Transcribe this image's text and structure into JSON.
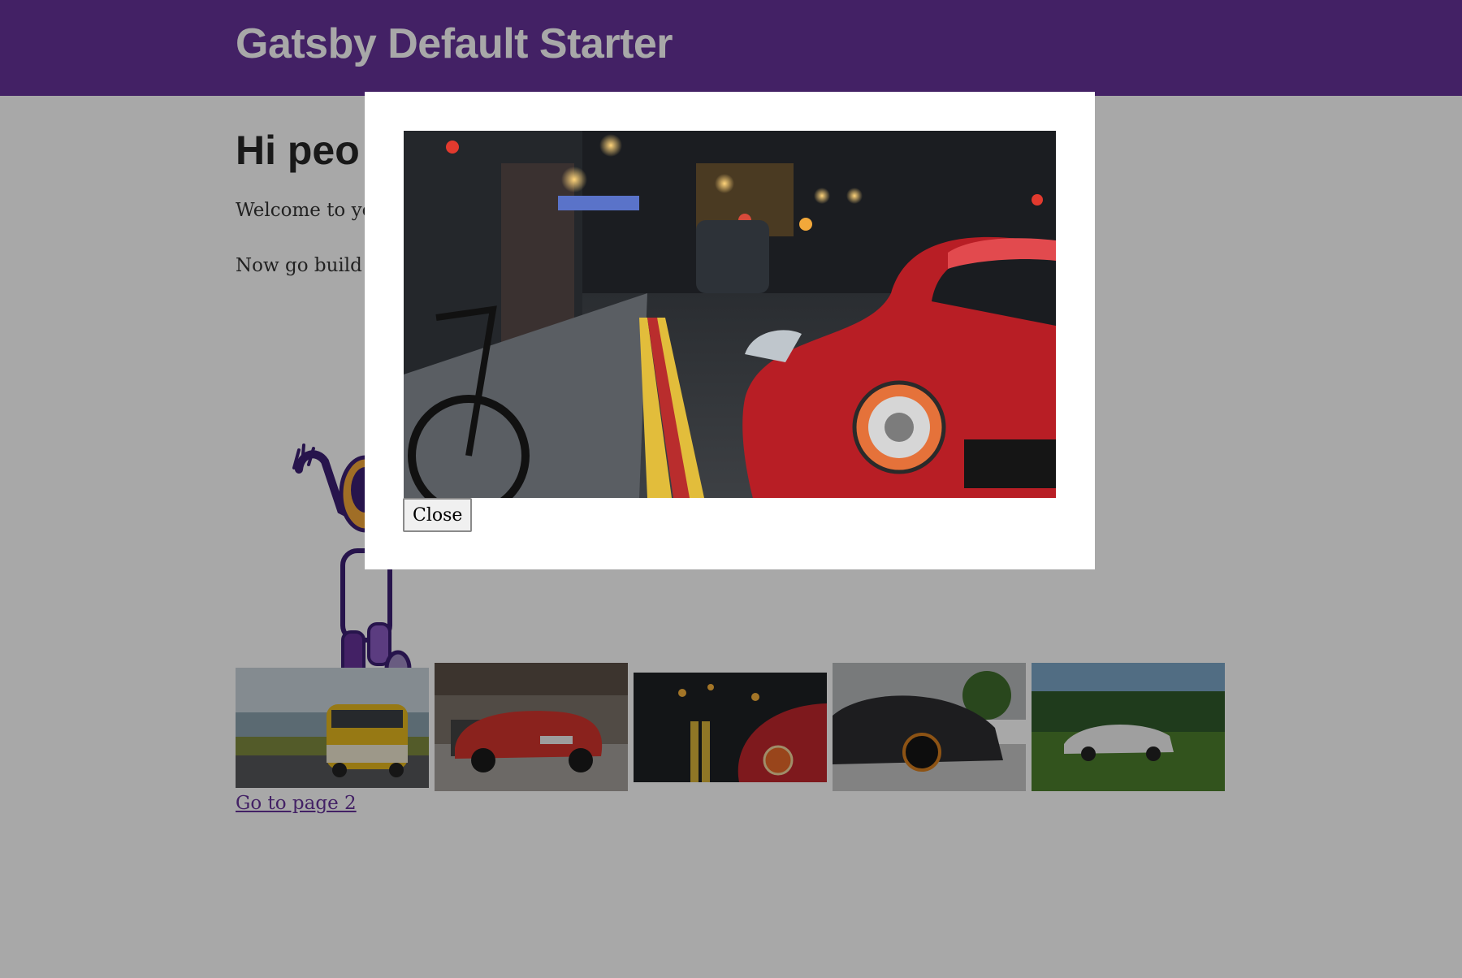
{
  "header": {
    "title": "Gatsby Default Starter",
    "background": "#663399"
  },
  "main": {
    "heading": "Hi peo",
    "paragraph1": "Welcome to you",
    "paragraph2": "Now go build s",
    "link_page2": "Go to page 2",
    "link_color": "#663399"
  },
  "illustration": {
    "icon": "astronaut-icon"
  },
  "gallery": {
    "thumbnails": [
      {
        "subject": "yellow-van-by-sea"
      },
      {
        "subject": "red-sports-car-garage"
      },
      {
        "subject": "red-car-city-night"
      },
      {
        "subject": "black-sports-car"
      },
      {
        "subject": "white-car-on-grass"
      }
    ]
  },
  "modal": {
    "image_subject": "red-car-city-night",
    "close_label": "Close",
    "overlay_color": "rgba(0,0,0,0.34)"
  }
}
